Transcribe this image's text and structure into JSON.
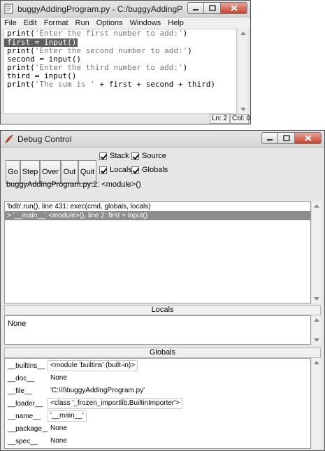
{
  "editor_window": {
    "title": "buggyAddingProgram.py - C:/buggyAddingProgram.py ...",
    "menu": [
      "File",
      "Edit",
      "Format",
      "Run",
      "Options",
      "Windows",
      "Help"
    ],
    "code_lines": [
      {
        "before": "print(",
        "string": "'Enter the first number to add:'",
        "after": ")"
      },
      {
        "before": "first = input()",
        "string": "",
        "after": ""
      },
      {
        "before": "print(",
        "string": "'Enter the second number to add:'",
        "after": ")"
      },
      {
        "before": "second = input()",
        "string": "",
        "after": ""
      },
      {
        "before": "print(",
        "string": "'Enter the third number to add:'",
        "after": ")"
      },
      {
        "before": "third = input()",
        "string": "",
        "after": ""
      },
      {
        "before": "print(",
        "string": "'The sum is '",
        "after": " + first + second + third)"
      }
    ],
    "status": {
      "line": "Ln: 2",
      "col": "Col: 0"
    }
  },
  "debug_window": {
    "title": "Debug Control",
    "buttons": {
      "go": "Go",
      "step": "Step",
      "over": "Over",
      "out": "Out",
      "quit": "Quit"
    },
    "checkboxes": {
      "stack": "Stack",
      "source": "Source",
      "locals": "Locals",
      "globals": "Globals"
    },
    "location": "buggyAddingProgram.py:2: <module>()",
    "stack": [
      "'bdb'.run(), line 431: exec(cmd, globals, locals)",
      "> '__main__'.<module>(), line 2: first = input()"
    ],
    "locals_header": "Locals",
    "locals_value": "None",
    "globals_header": "Globals",
    "globals": [
      {
        "name": "__builtins__",
        "value": "<module 'builtins' (built-in)>"
      },
      {
        "name": "__doc__",
        "value": "None"
      },
      {
        "name": "__file__",
        "value": "'C:\\\\\\\\buggyAddingProgram.py'"
      },
      {
        "name": "__loader__",
        "value": "<class '_frozen_importlib.BuiltinImporter'>"
      },
      {
        "name": "__name__",
        "value": "'__main__'"
      },
      {
        "name": "__package__",
        "value": "None"
      },
      {
        "name": "__spec__",
        "value": "None"
      }
    ]
  }
}
